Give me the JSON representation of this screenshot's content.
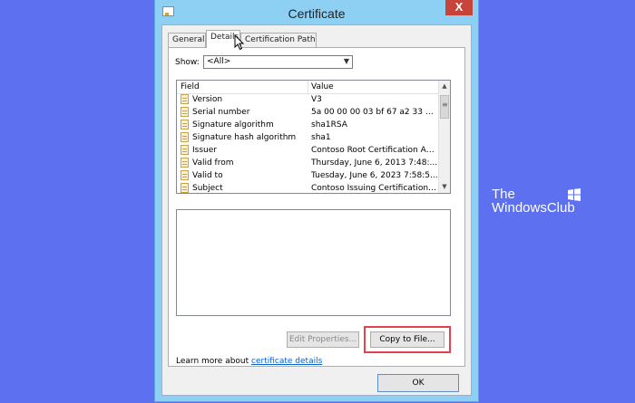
{
  "window": {
    "title": "Certificate",
    "close_glyph": "X"
  },
  "tabs": [
    {
      "label": "General",
      "active": false
    },
    {
      "label": "Details",
      "active": true
    },
    {
      "label": "Certification Path",
      "active": false
    }
  ],
  "show": {
    "label": "Show:",
    "selected": "<All>"
  },
  "list": {
    "headers": {
      "field": "Field",
      "value": "Value"
    },
    "rows": [
      {
        "field": "Version",
        "value": "V3"
      },
      {
        "field": "Serial number",
        "value": "5a 00 00 00 03 bf 67 a2 33 35..."
      },
      {
        "field": "Signature algorithm",
        "value": "sha1RSA"
      },
      {
        "field": "Signature hash algorithm",
        "value": "sha1"
      },
      {
        "field": "Issuer",
        "value": "Contoso Root Certification Aut..."
      },
      {
        "field": "Valid from",
        "value": "Thursday, June 6, 2013 7:48:..."
      },
      {
        "field": "Valid to",
        "value": "Tuesday, June 6, 2023 7:58:5..."
      },
      {
        "field": "Subject",
        "value": "Contoso Issuing Certification ..."
      }
    ]
  },
  "buttons": {
    "edit_properties": "Edit Properties...",
    "copy_to_file": "Copy to File...",
    "ok": "OK"
  },
  "learn_more": {
    "prefix": "Learn more about ",
    "link": "certificate details"
  },
  "watermark": {
    "line1": "The",
    "line2": "WindowsClub"
  },
  "colors": {
    "background": "#5c70f0",
    "highlight": "#e0424e",
    "link": "#0a5fc8"
  }
}
